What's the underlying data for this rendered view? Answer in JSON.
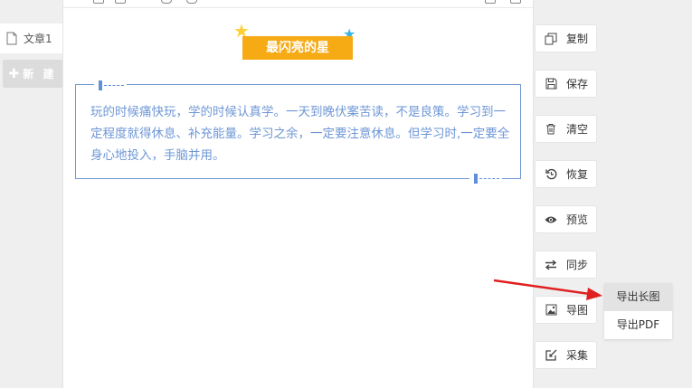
{
  "sidebar": {
    "doc_tab_label": "文章1",
    "new_button_label": "新 建"
  },
  "editor": {
    "title": "最闪亮的星",
    "paragraph": "玩的时候痛快玩，学的时候认真学。一天到晚伏案苦读，不是良策。学习到一定程度就得休息、补充能量。学习之余，一定要注意休息。但学习时,一定要全身心地投入，手脑并用。"
  },
  "actions": {
    "copy": "复制",
    "save": "保存",
    "clear": "清空",
    "restore": "恢复",
    "preview": "预览",
    "sync": "同步",
    "export_image": "导图",
    "collect": "采集"
  },
  "export_menu": {
    "long_image": "导出长图",
    "pdf": "导出PDF"
  },
  "colors": {
    "accent_title": "#f6aa14",
    "quote_blue": "#6e97d6",
    "arrow_red": "#e02020"
  },
  "icons": [
    "document-icon",
    "plus-icon",
    "copy-icon",
    "save-icon",
    "trash-icon",
    "restore-icon",
    "eye-icon",
    "sync-icon",
    "image-icon",
    "collect-icon"
  ]
}
